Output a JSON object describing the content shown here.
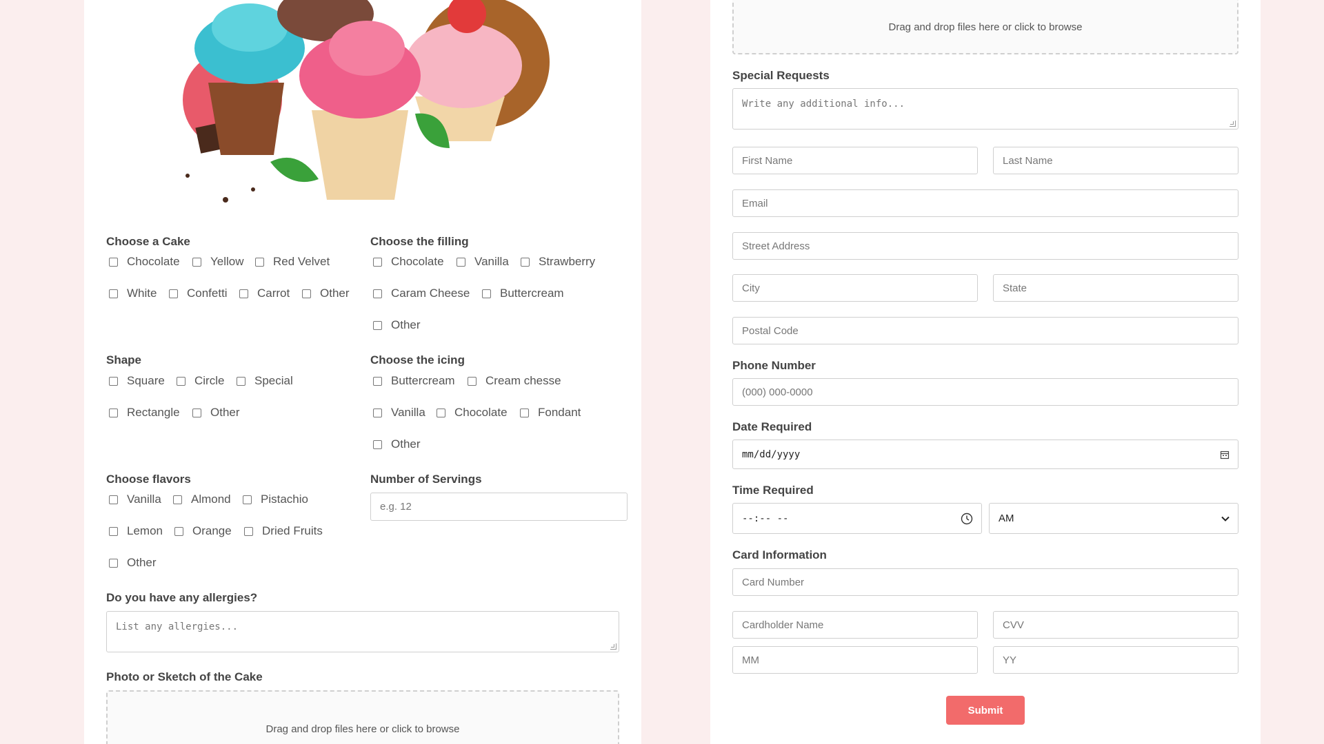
{
  "left": {
    "cake": {
      "label": "Choose a Cake",
      "options": [
        "Chocolate",
        "Yellow",
        "Red Velvet",
        "White",
        "Confetti",
        "Carrot",
        "Other"
      ]
    },
    "filling": {
      "label": "Choose the filling",
      "options": [
        "Chocolate",
        "Vanilla",
        "Strawberry",
        "Caram Cheese",
        "Buttercream",
        "Other"
      ]
    },
    "shape": {
      "label": "Shape",
      "options": [
        "Square",
        "Circle",
        "Special",
        "Rectangle",
        "Other"
      ]
    },
    "icing": {
      "label": "Choose the icing",
      "options": [
        "Buttercream",
        "Cream chesse",
        "Vanilla",
        "Chocolate",
        "Fondant",
        "Other"
      ]
    },
    "flavors": {
      "label": "Choose flavors",
      "options": [
        "Vanilla",
        "Almond",
        "Pistachio",
        "Lemon",
        "Orange",
        "Dried Fruits",
        "Other"
      ]
    },
    "servings": {
      "label": "Number of Servings",
      "placeholder": "e.g. 12"
    },
    "allergies": {
      "label": "Do you have any allergies?",
      "placeholder": "List any allergies..."
    },
    "photo": {
      "label": "Photo or Sketch of the Cake",
      "dropzone_text": "Drag and drop files here or click to browse"
    }
  },
  "right": {
    "upload": {
      "dropzone_text": "Drag and drop files here or click to browse"
    },
    "special_requests": {
      "label": "Special Requests",
      "placeholder": "Write any additional info..."
    },
    "name": {
      "first_placeholder": "First Name",
      "last_placeholder": "Last Name"
    },
    "email_placeholder": "Email",
    "street_placeholder": "Street Address",
    "city_placeholder": "City",
    "state_placeholder": "State",
    "postal_placeholder": "Postal Code",
    "phone": {
      "label": "Phone Number",
      "placeholder": "(000) 000-0000"
    },
    "date": {
      "label": "Date Required",
      "placeholder": "mm/dd/yyyy"
    },
    "time": {
      "label": "Time Required",
      "placeholder": "--:-- --",
      "ampm_selected": "AM"
    },
    "card": {
      "label": "Card Information",
      "number_placeholder": "Card Number",
      "holder_placeholder": "Cardholder Name",
      "cvv_placeholder": "CVV",
      "mm_placeholder": "MM",
      "yy_placeholder": "YY"
    },
    "submit_label": "Submit"
  },
  "colors": {
    "page_bg": "#fbeeee",
    "accent": "#f26b6b"
  },
  "icons": {
    "date": "calendar-icon",
    "time": "clock-icon",
    "select": "chevron-down-icon"
  }
}
